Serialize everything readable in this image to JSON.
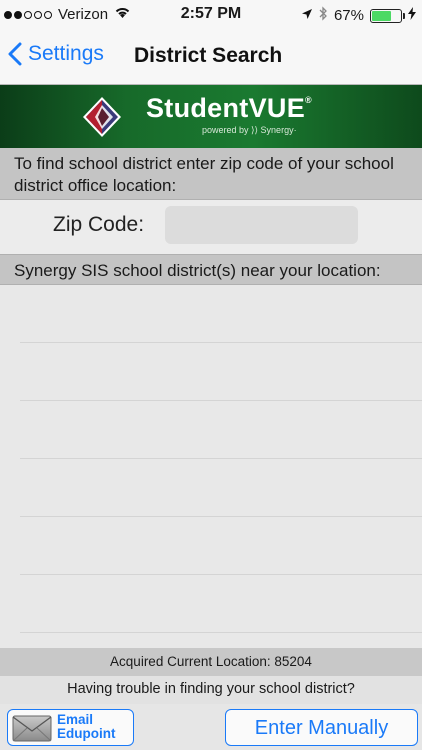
{
  "status_bar": {
    "signal_dots_filled": 2,
    "signal_dots_total": 5,
    "carrier": "Verizon",
    "time": "2:57 PM",
    "battery": "67%",
    "battery_level": 0.67,
    "battery_color": "#4cd964",
    "icons": [
      "wifi-icon",
      "location-arrow-icon",
      "bluetooth-icon",
      "battery-icon",
      "charging-icon"
    ]
  },
  "nav": {
    "back_label": "Settings",
    "title": "District Search",
    "accent": "#1a7af8"
  },
  "banner": {
    "brand": "StudentVUE",
    "trademark": "®",
    "powered_by": "powered by ⟩⟩ Synergy·"
  },
  "search": {
    "instruction": "To find school district enter zip code of your school district office location:",
    "zip_label": "Zip Code:",
    "zip_value": "",
    "zip_placeholder": ""
  },
  "results": {
    "header": "Synergy SIS school district(s) near your location:",
    "items": [
      "",
      "",
      "",
      "",
      "",
      ""
    ]
  },
  "location": {
    "acquired": "Acquired Current Location: 85204"
  },
  "help": {
    "trouble": "Having trouble in finding your school district?"
  },
  "footer": {
    "email_line1": "Email",
    "email_line2": "Edupoint",
    "enter_manually": "Enter Manually"
  }
}
